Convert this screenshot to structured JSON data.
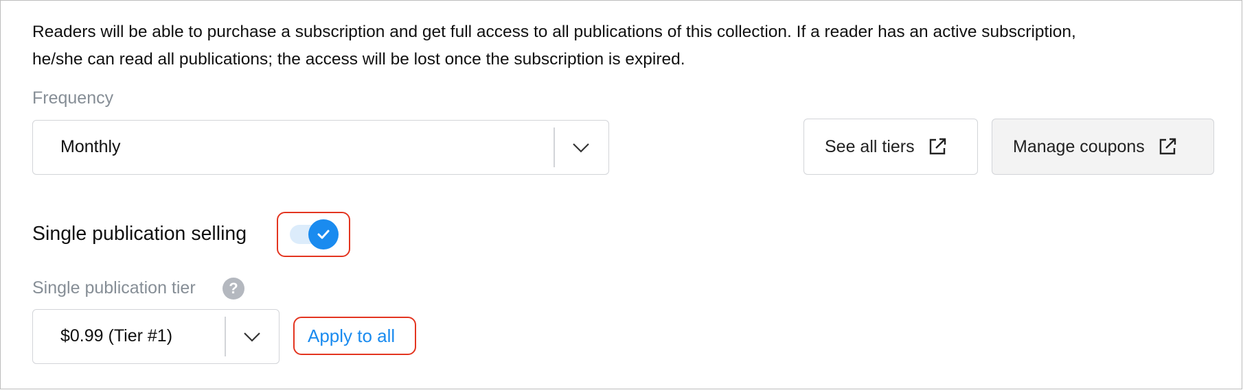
{
  "description": {
    "line1": "Readers will be able to purchase a subscription and get full access to all publications of this collection. If a reader has an active subscription,",
    "line2": "he/she can read all publications; the access will be lost once the subscription is expired."
  },
  "frequency": {
    "label": "Frequency",
    "value": "Monthly"
  },
  "buttons": {
    "see_all_tiers": "See all tiers",
    "manage_coupons": "Manage coupons"
  },
  "single_publication": {
    "title": "Single publication selling",
    "toggle_on": true,
    "tier_label": "Single publication tier",
    "help_glyph": "?",
    "tier_value": "$0.99 (Tier #1)",
    "apply_all": "Apply to all"
  },
  "colors": {
    "accent": "#1a8bef",
    "highlight": "#e3341f",
    "muted_text": "#868e96"
  },
  "icons": [
    "chevron-down-icon",
    "external-link-icon",
    "check-icon",
    "help-icon"
  ]
}
